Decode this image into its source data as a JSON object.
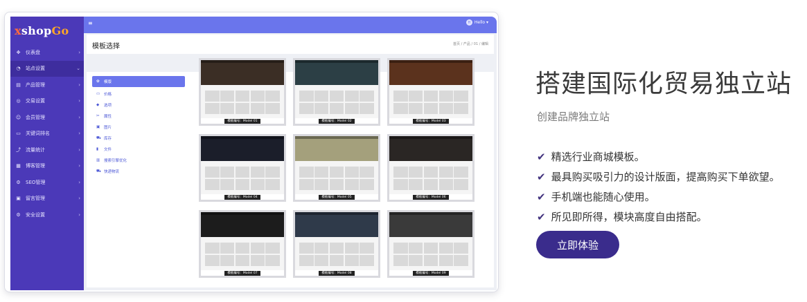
{
  "admin": {
    "brand": {
      "x": "x",
      "shop": "shop",
      "go": "Go"
    },
    "topbar": {
      "menu_icon": "menu-icon",
      "user_initial": "H",
      "user_name": "Hello ▾"
    },
    "page_title": "模板选择",
    "breadcrumb": "首页 / 产品 / 01 / 编辑",
    "nav": [
      {
        "icon": "✥",
        "label": "仪表盘",
        "active": false
      },
      {
        "icon": "◔",
        "label": "站点设置",
        "active": true
      },
      {
        "icon": "▤",
        "label": "产品管理",
        "active": false
      },
      {
        "icon": "◎",
        "label": "交易设置",
        "active": false
      },
      {
        "icon": "☺",
        "label": "会员管理",
        "active": false
      },
      {
        "icon": "▭",
        "label": "关键词排名",
        "active": false
      },
      {
        "icon": "⤴",
        "label": "流量统计",
        "active": false
      },
      {
        "icon": "▦",
        "label": "博客管理",
        "active": false
      },
      {
        "icon": "⚙",
        "label": "SEO管理",
        "active": false
      },
      {
        "icon": "▣",
        "label": "留言管理",
        "active": false
      },
      {
        "icon": "⚙",
        "label": "安全设置",
        "active": false
      }
    ],
    "nav_chevron": "›",
    "nav_chevron_open": "⌄",
    "submenu": [
      {
        "icon": "✿",
        "label": "模版",
        "active": true
      },
      {
        "icon": "▭",
        "label": "价格",
        "active": false
      },
      {
        "icon": "◆",
        "label": "选项",
        "active": false
      },
      {
        "icon": "✂",
        "label": "属性",
        "active": false
      },
      {
        "icon": "▣",
        "label": "图片",
        "active": false
      },
      {
        "icon": "⛟",
        "label": "库存",
        "active": false
      },
      {
        "icon": "▮",
        "label": "文件",
        "active": false
      },
      {
        "icon": "▥",
        "label": "搜索引擎优化",
        "active": false
      },
      {
        "icon": "⛟",
        "label": "快递物流",
        "active": false
      }
    ],
    "templates": [
      {
        "label": "模板编号：Model 01",
        "hero": "#3b2e25"
      },
      {
        "label": "模板编号：Model 02",
        "hero": "#2c3f45"
      },
      {
        "label": "模板编号：Model 03",
        "hero": "#5b321d"
      },
      {
        "label": "模板编号：Model 04",
        "hero": "#1b1e2a"
      },
      {
        "label": "模板编号：Model 05",
        "hero": "#a4a07c"
      },
      {
        "label": "模板编号：Model 06",
        "hero": "#2a2624"
      },
      {
        "label": "模板编号：Model 07",
        "hero": "#1c1c1c"
      },
      {
        "label": "模板编号：Model 08",
        "hero": "#2f3a4a"
      },
      {
        "label": "模板编号：Model 09",
        "hero": "#3a3a3a"
      }
    ]
  },
  "marketing": {
    "headline": "搭建国际化贸易独立站",
    "subheadline": "创建品牌独立站",
    "features": [
      "精选行业商城模板。",
      "最具购买吸引力的设计版面，提高购买下单欲望。",
      "手机端也能随心使用。",
      "所见即所得，模块高度自由搭配。"
    ],
    "check_icon": "✔",
    "cta": "立即体验"
  },
  "colors": {
    "sidebar": "#4b39b8",
    "topbar": "#6a75ec",
    "accent_dark": "#3a2c8c"
  }
}
